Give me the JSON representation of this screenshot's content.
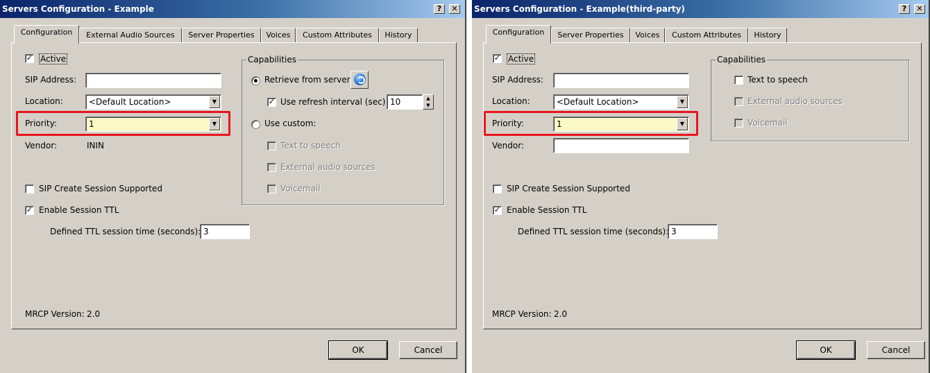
{
  "left": {
    "title": "Servers Configuration - Example",
    "help_btn": "?",
    "close_btn": "✕",
    "tabs": [
      "Configuration",
      "External Audio Sources",
      "Server Properties",
      "Voices",
      "Custom Attributes",
      "History"
    ],
    "active_label": "Active",
    "sip_label": "SIP Address:",
    "sip_value": "",
    "location_label": "Location:",
    "location_value": "<Default Location>",
    "priority_label": "Priority:",
    "priority_value": "1",
    "vendor_label": "Vendor:",
    "vendor_value": "ININ",
    "sip_session_label": "SIP Create Session Supported",
    "enable_ttl_label": "Enable Session TTL",
    "ttl_label": "Defined TTL session time (seconds):",
    "ttl_value": "3",
    "mrcp_label": "MRCP Version:",
    "mrcp_value": "2.0",
    "capabilities_title": "Capabilities",
    "retrieve_label": "Retrieve from server",
    "refresh_label": "Use refresh interval (sec)",
    "refresh_value": "10",
    "use_custom_label": "Use custom:",
    "tts_label": "Text to speech",
    "ext_audio_label": "External audio sources",
    "voicemail_label": "Voicemail",
    "ok_label": "OK",
    "cancel_label": "Cancel"
  },
  "right": {
    "title": "Servers Configuration - Example(third-party)",
    "help_btn": "?",
    "close_btn": "✕",
    "tabs": [
      "Configuration",
      "Server Properties",
      "Voices",
      "Custom Attributes",
      "History"
    ],
    "active_label": "Active",
    "sip_label": "SIP Address:",
    "sip_value": "",
    "location_label": "Location:",
    "location_value": "<Default Location>",
    "priority_label": "Priority:",
    "priority_value": "1",
    "vendor_label": "Vendor:",
    "vendor_value": "",
    "sip_session_label": "SIP Create Session Supported",
    "enable_ttl_label": "Enable Session TTL",
    "ttl_label": "Defined TTL session time (seconds):",
    "ttl_value": "3",
    "mrcp_label": "MRCP Version:",
    "mrcp_value": "2.0",
    "capabilities_title": "Capabilities",
    "tts_label": "Text to speech",
    "ext_audio_label": "External audio sources",
    "voicemail_label": "Voicemail",
    "ok_label": "OK",
    "cancel_label": "Cancel"
  },
  "symbols": {
    "check": "✓",
    "arrow_down": "▼",
    "spin_up": "▲",
    "spin_down": "▼"
  },
  "colors": {
    "highlight_box": "#e8151f",
    "priority_field_bg": "#fbf9c6",
    "title_bar": "#0a246a"
  }
}
